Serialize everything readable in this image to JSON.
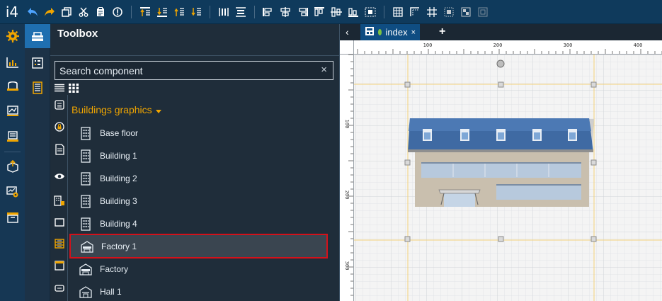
{
  "app": {
    "logo": "i4"
  },
  "toolbox": {
    "title": "Toolbox",
    "search_placeholder": "Search component",
    "search_clear": "×",
    "category": "Buildings graphics",
    "items": [
      {
        "label": "Base floor",
        "icon": "building-icon"
      },
      {
        "label": "Building 1",
        "icon": "building-icon"
      },
      {
        "label": "Building 2",
        "icon": "building-icon"
      },
      {
        "label": "Building 3",
        "icon": "building-icon"
      },
      {
        "label": "Building 4",
        "icon": "building-icon"
      },
      {
        "label": "Factory 1",
        "icon": "factory-icon",
        "selected": true
      },
      {
        "label": "Factory",
        "icon": "factory-icon"
      },
      {
        "label": "Hall 1",
        "icon": "hall-icon"
      }
    ]
  },
  "editor": {
    "tab_label": "index",
    "tab_close": "×",
    "tab_add": "+",
    "tab_nav": "‹",
    "status_color": "#7cc142"
  },
  "ruler": {
    "x_ticks": [
      "100",
      "200",
      "300",
      "400"
    ],
    "y_ticks": [
      "100",
      "200",
      "300"
    ]
  },
  "colors": {
    "accent": "#f0a500",
    "toolbar_bg": "#0f3a5c",
    "selection": "#d4111a",
    "tab_bg": "#0f4d82"
  }
}
